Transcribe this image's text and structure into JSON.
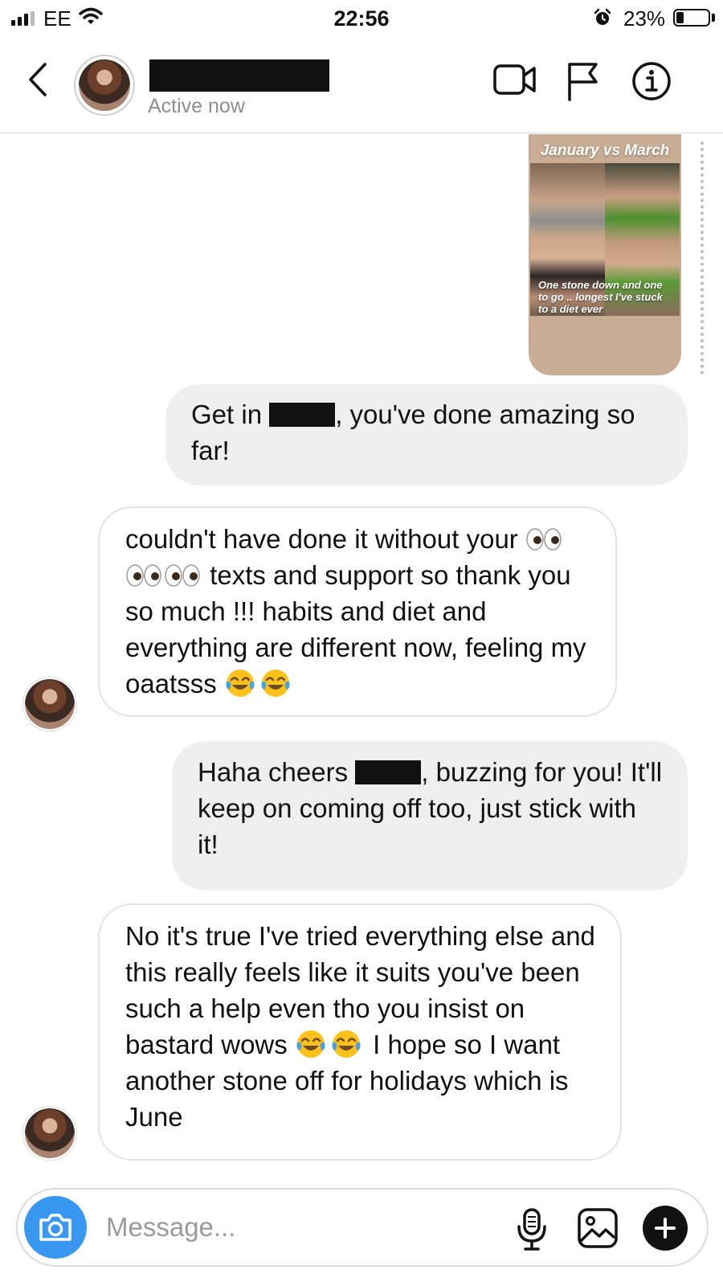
{
  "status_bar": {
    "carrier": "EE",
    "time": "22:56",
    "battery_percent": "23%",
    "battery_level": 0.23,
    "icons": [
      "signal-icon",
      "wifi-icon",
      "alarm-icon",
      "battery-icon"
    ]
  },
  "header": {
    "status": "Active now",
    "icons": [
      "back-icon",
      "video-call-icon",
      "flag-icon",
      "info-icon"
    ]
  },
  "story": {
    "title": "January vs March",
    "caption": "One stone down and one to go .. longest I've stuck to a diet ever"
  },
  "messages": {
    "m1": {
      "sender": "me",
      "before": "Get in",
      "after": ", you've done amazing so far!"
    },
    "m2": {
      "sender": "them",
      "line1": "couldn't have done it without your",
      "line2": "texts and support so thank you so much !!! habits and diet and everything are different now, feeling my oaatsss",
      "emoji": [
        "eyes-emoji",
        "eyes-emoji",
        "eyes-emoji",
        "tears-of-joy-emoji",
        "tears-of-joy-emoji"
      ]
    },
    "m3": {
      "sender": "me",
      "before": "Haha cheers",
      "after": ", buzzing for you! It'll keep on coming off too, just stick with it!"
    },
    "m4": {
      "sender": "them",
      "before": "No it's true I've tried everything else and this really feels like it suits you've been such a help even tho you insist on bastard wows",
      "after": "I hope so I want another stone off for holidays which is June",
      "emoji": [
        "tears-of-joy-emoji",
        "tears-of-joy-emoji"
      ]
    }
  },
  "composer": {
    "placeholder": "Message...",
    "icons": [
      "camera-icon",
      "microphone-icon",
      "gallery-icon",
      "plus-icon"
    ]
  },
  "colors": {
    "accent": "#3897f0",
    "sent_bubble": "#efefef",
    "muted_text": "#8e8e8e"
  }
}
